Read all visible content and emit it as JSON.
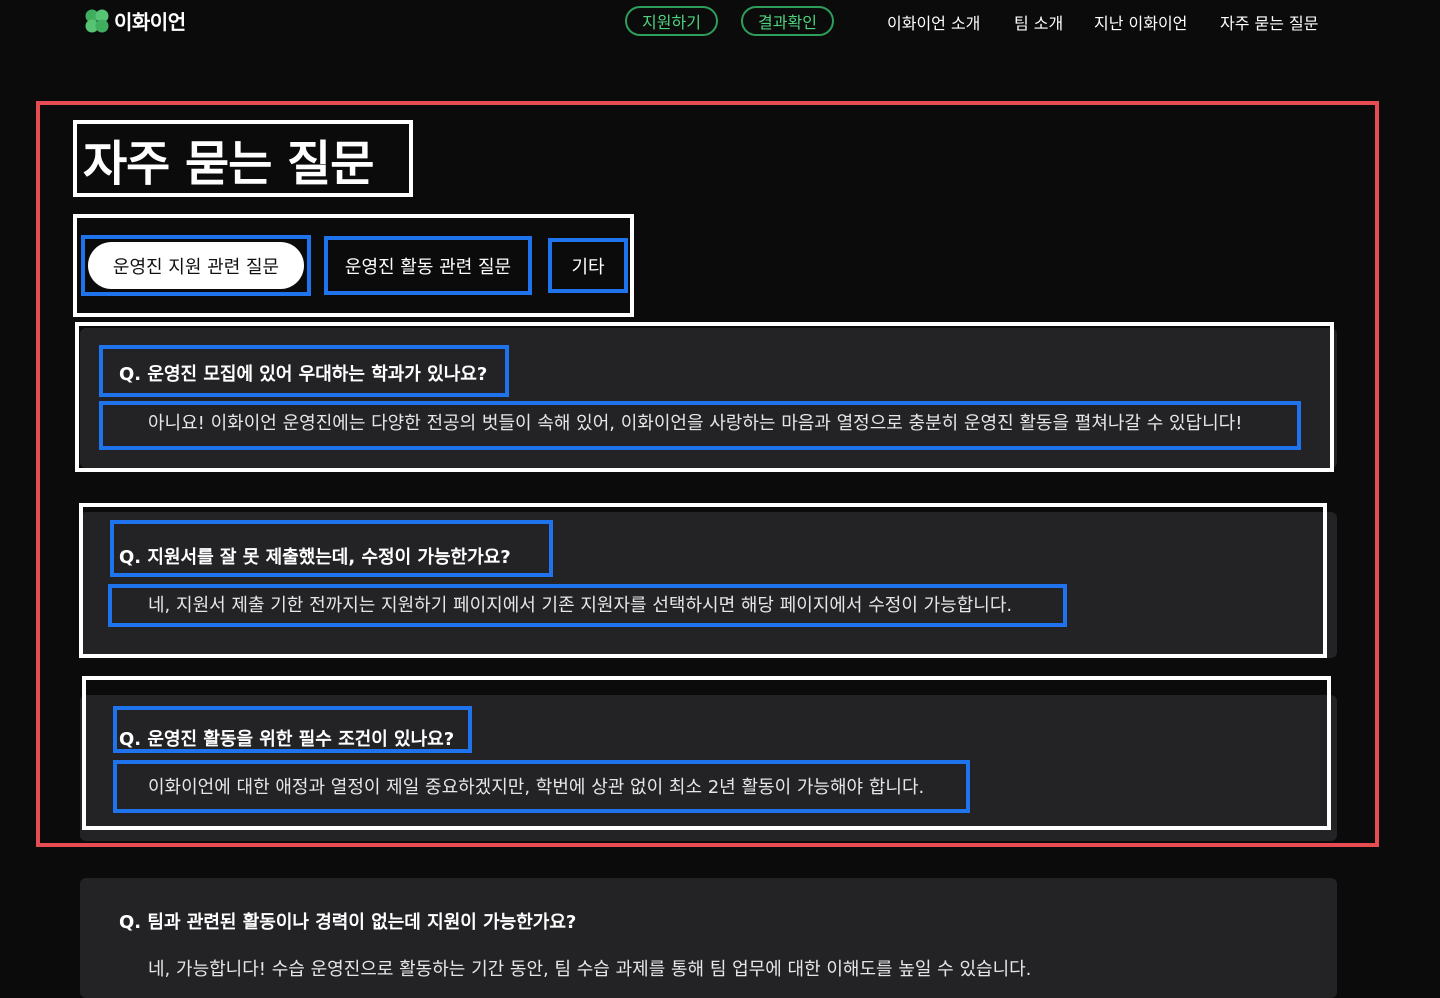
{
  "header": {
    "logo_text": "이화이언",
    "apply_button": "지원하기",
    "result_button": "결과확인",
    "nav": [
      "이화이언 소개",
      "팀 소개",
      "지난 이화이언",
      "자주 묻는 질문"
    ]
  },
  "colors": {
    "accent_green": "#4fd27e",
    "annotation_red": "#e84c53",
    "annotation_blue": "#1f74ee",
    "card_bg": "#232326"
  },
  "page": {
    "title": "자주 묻는 질문",
    "tabs": [
      {
        "label": "운영진 지원 관련 질문",
        "active": true
      },
      {
        "label": "운영진 활동 관련 질문",
        "active": false
      },
      {
        "label": "기타",
        "active": false
      }
    ]
  },
  "faq": [
    {
      "question": "Q. 운영진 모집에 있어 우대하는 학과가 있나요?",
      "answer": "아니요! 이화이언 운영진에는 다양한 전공의 벗들이 속해 있어, 이화이언을 사랑하는 마음과 열정으로 충분히 운영진 활동을 펼쳐나갈 수 있답니다!"
    },
    {
      "question": "Q. 지원서를 잘 못 제출했는데, 수정이 가능한가요?",
      "answer": "네, 지원서 제출 기한 전까지는 지원하기 페이지에서 기존 지원자를 선택하시면 해당 페이지에서 수정이 가능합니다."
    },
    {
      "question": "Q. 운영진 활동을 위한 필수 조건이 있나요?",
      "answer": "이화이언에 대한 애정과 열정이 제일 중요하겠지만, 학번에 상관 없이 최소 2년 활동이 가능해야 합니다."
    },
    {
      "question": "Q. 팀과 관련된 활동이나 경력이 없는데 지원이 가능한가요?",
      "answer": "네, 가능합니다! 수습 운영진으로 활동하는 기간 동안, 팀 수습 과제를 통해 팀 업무에 대한 이해도를 높일 수 있습니다."
    }
  ]
}
